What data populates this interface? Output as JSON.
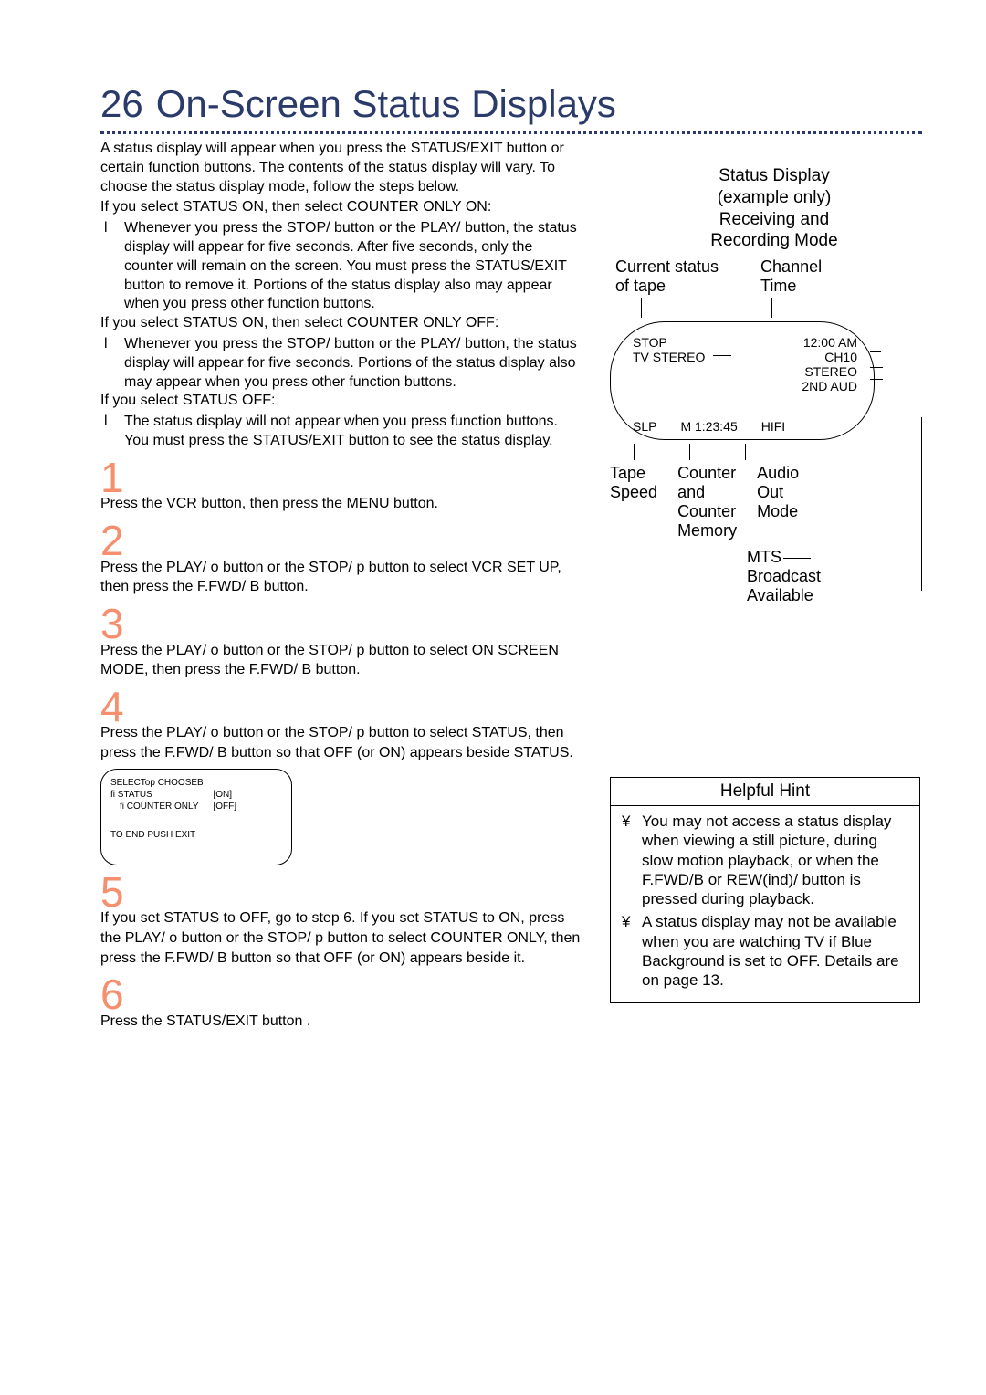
{
  "header": {
    "page_number": "26",
    "title": "On-Screen Status Displays"
  },
  "intro": {
    "p1": "A status display will appear when you press the STATUS/EXIT button or certain function buttons. The contents of the status display will vary. To choose the status display mode, follow the steps below.",
    "sel1": "If you select STATUS ON, then select COUNTER    ONLY ON:",
    "b1": "Whenever you press the STOP/ button or the PLAY/  button, the status display will appear for five seconds. After five seconds, only the counter will remain on the screen. You must press the STATUS/EXIT button to remove it. Portions of the status display also may appear when you press other function buttons.",
    "sel2": "If you select STATUS ON, then select COUNTER    ONLY OFF:",
    "b2": "Whenever you press the STOP/ button or the PLAY/  button, the status display will appear for five seconds. Portions of the status display also may appear when you press other function buttons.",
    "sel3": "If you select STATUS  OFF:",
    "b3": "The status display will not appear when you press function buttons. You must press the STATUS/EXIT button to see the status display."
  },
  "steps": {
    "n1": "1",
    "t1": "Press the VCR button, then press the MENU button.",
    "n2": "2",
    "t2": "Press the PLAY/ o  button or the STOP/  p  button to select VCR SET UP, then press the F.FWD/  B  button.",
    "n3": "3",
    "t3": "Press the PLAY/ o  button or the STOP/  p  button to select ON SCREEN MODE, then press the F.FWD/  B  button.",
    "n4": "4",
    "t4": "Press the PLAY/ o  button or the STOP/  p  button to select STATUS, then press the F.FWD/  B  button so that OFF (or ON)  appears beside STATUS.",
    "n5": "5",
    "t5": "If you set STATUS to OFF, go to step 6. If you set STATUS to ON, press the PLAY/  o  button or the STOP/  p button to select COUNTER ONLY, then press the F.FWD/ B  button so that OFF (or ON)    appears beside it.",
    "n6": "6",
    "t6": "Press the STATUS/EXIT button  ."
  },
  "osd": {
    "row1": "SELECTop  CHOOSEB",
    "label_status": "STATUS",
    "label_counter": "COUNTER ONLY",
    "val_status": "[ON]",
    "val_counter": "[OFF]",
    "end": "TO END PUSH EXIT"
  },
  "status_display": {
    "head1": "Status Display",
    "head2": "(example only)",
    "head3": "Receiving and",
    "head4": "Recording Mode",
    "lbl_current1": "Current status",
    "lbl_current2": "of tape",
    "lbl_channel": "Channel",
    "lbl_time": "Time",
    "tv": {
      "stop": "STOP",
      "tvstereo": "TV STEREO",
      "time": "12:00 AM",
      "ch": "CH10",
      "stereo": "STEREO",
      "aud2": "2ND AUD",
      "slp": "SLP",
      "counter": "M  1:23:45",
      "hifi": "HIFI"
    },
    "lbl_tape1": "Tape",
    "lbl_tape2": "Speed",
    "lbl_cnt1": "Counter",
    "lbl_cnt2": "and",
    "lbl_cnt3": "Counter",
    "lbl_cnt4": "Memory",
    "lbl_aud1": "Audio",
    "lbl_aud2": "Out",
    "lbl_aud3": "Mode",
    "lbl_mts1": "MTS",
    "lbl_mts2": "Broadcast",
    "lbl_mts3": "Available"
  },
  "hint": {
    "title": "Helpful Hint",
    "i1": "You may not access a status display when viewing a still picture, during slow motion playback, or when the F.FWD/B  or REW(ind)/  button is pressed during playback.",
    "i2": "A status display may not be available when you are watching TV if Blue Background is set to OFF. Details are on page 13."
  }
}
